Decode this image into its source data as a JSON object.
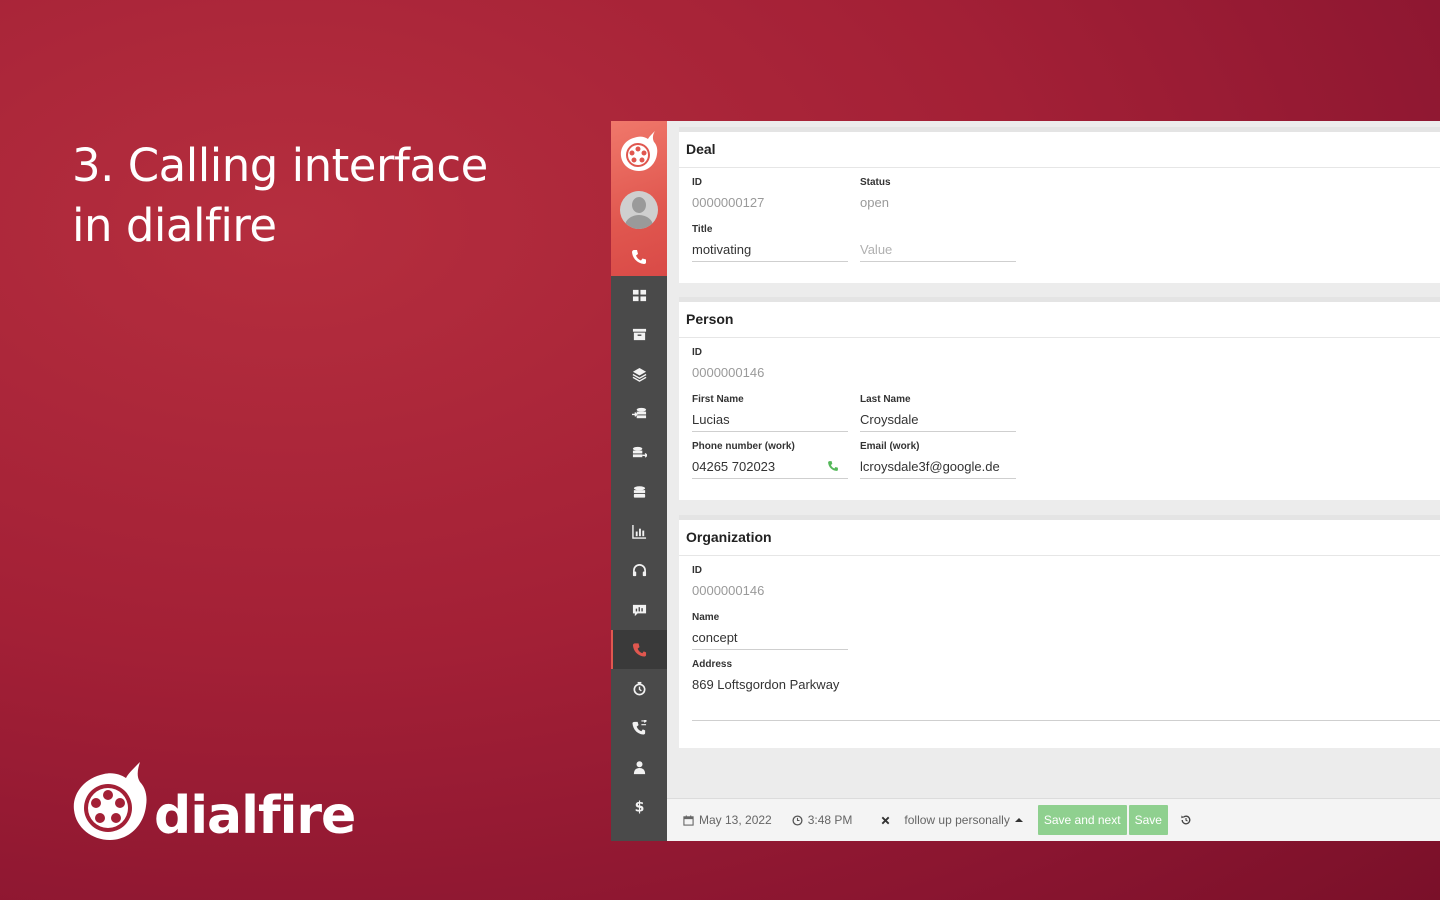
{
  "headline": {
    "line1": "3. Calling interface",
    "line2": "in dialfire"
  },
  "brand": {
    "name": "dialfire"
  },
  "colors": {
    "accent": "#e0574f",
    "background": "#a32036",
    "sidebar": "#4a4a4a",
    "button_green": "#8fd08f"
  },
  "sidebar": {
    "icons": [
      "dashboard-icon",
      "archive-icon",
      "layers-icon",
      "import-icon",
      "export-icon",
      "database-icon",
      "report-icon",
      "headset-icon",
      "chat-stats-icon",
      "phone-icon",
      "timer-icon",
      "call-forward-icon",
      "user-icon",
      "dollar-icon"
    ],
    "active": "phone-icon"
  },
  "deal": {
    "title": "Deal",
    "id_label": "ID",
    "id_value": "0000000127",
    "status_label": "Status",
    "status_value": "open",
    "title_label": "Title",
    "title_value": "motivating",
    "value_placeholder": "Value"
  },
  "person": {
    "title": "Person",
    "id_label": "ID",
    "id_value": "0000000146",
    "first_name_label": "First Name",
    "first_name_value": "Lucias",
    "last_name_label": "Last Name",
    "last_name_value": "Croysdale",
    "phone_label": "Phone number (work)",
    "phone_value": "04265 702023",
    "email_label": "Email (work)",
    "email_value": "lcroysdale3f@google.de"
  },
  "organization": {
    "title": "Organization",
    "id_label": "ID",
    "id_value": "0000000146",
    "name_label": "Name",
    "name_value": "concept",
    "address_label": "Address",
    "address_value": "869 Loftsgordon Parkway"
  },
  "bottombar": {
    "date": "May 13, 2022",
    "time": "3:48 PM",
    "status_option": "follow up personally",
    "save_next_label": "Save and next",
    "save_label": "Save"
  }
}
